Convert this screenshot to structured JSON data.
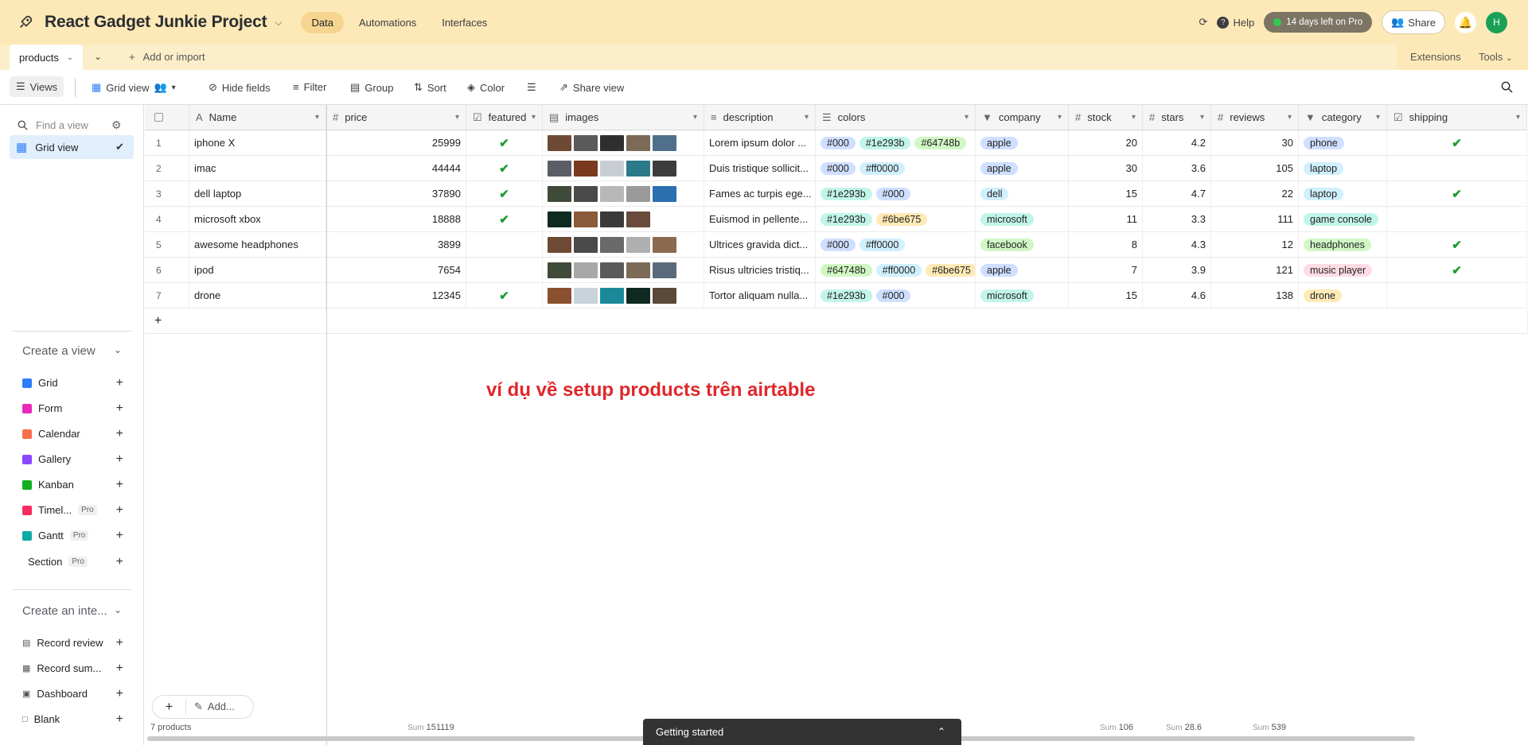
{
  "base": {
    "title": "React Gadget Junkie Project"
  },
  "nav": {
    "data": "Data",
    "automations": "Automations",
    "interfaces": "Interfaces"
  },
  "top_right": {
    "help": "Help",
    "trial": "14 days left on Pro",
    "share": "Share",
    "avatar": "H"
  },
  "table_tab": {
    "name": "products",
    "add_import": "Add or import",
    "extensions": "Extensions",
    "tools": "Tools"
  },
  "viewbar": {
    "views": "Views",
    "view_name": "Grid view",
    "hide_fields": "Hide fields",
    "filter": "Filter",
    "group": "Group",
    "sort": "Sort",
    "color": "Color",
    "share_view": "Share view"
  },
  "sidebar": {
    "find_placeholder": "Find a view",
    "current_view": "Grid view",
    "create_view": "Create a view",
    "view_types": [
      {
        "label": "Grid",
        "color": "#2d7ff9",
        "pro": ""
      },
      {
        "label": "Form",
        "color": "#e929ba",
        "pro": ""
      },
      {
        "label": "Calendar",
        "color": "#f86f4b",
        "pro": ""
      },
      {
        "label": "Gallery",
        "color": "#8b46ff",
        "pro": ""
      },
      {
        "label": "Kanban",
        "color": "#11af22",
        "pro": ""
      },
      {
        "label": "Timel...",
        "color": "#f82b60",
        "pro": "Pro"
      },
      {
        "label": "Gantt",
        "color": "#0eaaa5",
        "pro": "Pro"
      },
      {
        "label": "Section",
        "color": "",
        "pro": "Pro"
      }
    ],
    "create_interface": "Create an inte...",
    "interface_types": [
      "Record review",
      "Record sum...",
      "Dashboard",
      "Blank"
    ]
  },
  "columns": [
    "Name",
    "price",
    "featured",
    "images",
    "description",
    "colors",
    "company",
    "stock",
    "stars",
    "reviews",
    "category",
    "shipping"
  ],
  "rows": [
    {
      "n": "1",
      "name": "iphone X",
      "price": "25999",
      "featured": true,
      "images": [
        "#6e4a35",
        "#5a5a5a",
        "#2f2f2f",
        "#7a6a56",
        "#4f6f8a"
      ],
      "description": "Lorem ipsum dolor ...",
      "colors": [
        "#000",
        "#1e293b",
        "#64748b"
      ],
      "company": "apple",
      "stock": "20",
      "stars": "4.2",
      "reviews": "30",
      "category": "phone",
      "shipping": true
    },
    {
      "n": "2",
      "name": "imac",
      "price": "44444",
      "featured": true,
      "images": [
        "#5b5e66",
        "#7a3a20",
        "#c9ced5",
        "#2a7a8a",
        "#3d3d3d"
      ],
      "description": "Duis tristique sollicit...",
      "colors": [
        "#000",
        "#ff0000"
      ],
      "company": "apple",
      "stock": "30",
      "stars": "3.6",
      "reviews": "105",
      "category": "laptop",
      "shipping": false
    },
    {
      "n": "3",
      "name": "dell laptop",
      "price": "37890",
      "featured": true,
      "images": [
        "#3f4a3a",
        "#4a4a4a",
        "#b8b8b8",
        "#9a9a9a",
        "#2b6fb0"
      ],
      "description": "Fames ac turpis ege...",
      "colors": [
        "#1e293b",
        "#000"
      ],
      "company": "dell",
      "stock": "15",
      "stars": "4.7",
      "reviews": "22",
      "category": "laptop",
      "shipping": true
    },
    {
      "n": "4",
      "name": "microsoft xbox",
      "price": "18888",
      "featured": true,
      "images": [
        "#0f2a20",
        "#8a5a3a",
        "#3a3a3a",
        "#6a4a3a"
      ],
      "description": "Euismod in pellente...",
      "colors": [
        "#1e293b",
        "#6be675"
      ],
      "company": "microsoft",
      "stock": "11",
      "stars": "3.3",
      "reviews": "111",
      "category": "game console",
      "shipping": false
    },
    {
      "n": "5",
      "name": "awesome headphones",
      "price": "3899",
      "featured": false,
      "images": [
        "#6e4a35",
        "#4a4a4a",
        "#6a6a6a",
        "#b0b0b0",
        "#8a6a50"
      ],
      "description": "Ultrices gravida dict...",
      "colors": [
        "#000",
        "#ff0000"
      ],
      "company": "facebook",
      "stock": "8",
      "stars": "4.3",
      "reviews": "12",
      "category": "headphones",
      "shipping": true
    },
    {
      "n": "6",
      "name": "ipod",
      "price": "7654",
      "featured": false,
      "images": [
        "#3f4a3a",
        "#a8a8a8",
        "#5a5a5a",
        "#7a6a56",
        "#5a6a7a"
      ],
      "description": "Risus ultricies tristiq...",
      "colors": [
        "#64748b",
        "#ff0000",
        "#6be675"
      ],
      "company": "apple",
      "stock": "7",
      "stars": "3.9",
      "reviews": "121",
      "category": "music player",
      "shipping": true
    },
    {
      "n": "7",
      "name": "drone",
      "price": "12345",
      "featured": true,
      "images": [
        "#8a5030",
        "#c9d3da",
        "#1a8a9a",
        "#0f2a20",
        "#5a4a3a"
      ],
      "description": "Tortor aliquam nulla...",
      "colors": [
        "#1e293b",
        "#000"
      ],
      "company": "microsoft",
      "stock": "15",
      "stars": "4.6",
      "reviews": "138",
      "category": "drone",
      "shipping": false
    }
  ],
  "company_colors": {
    "apple": "#cfdfff",
    "dell": "#d0f0fd",
    "microsoft": "#c2f5e9",
    "facebook": "#d1f7c4"
  },
  "category_colors": {
    "phone": "#cfdfff",
    "laptop": "#d0f0fd",
    "game console": "#c2f5e9",
    "headphones": "#d1f7c4",
    "music player": "#ffdce5",
    "drone": "#ffeab6"
  },
  "color_pill_colors": {
    "#000": "#cfdfff",
    "#1e293b": "#c2f5e9",
    "#64748b": "#d1f7c4",
    "#ff0000": "#d0f0fd",
    "#6be675": "#ffeab6"
  },
  "footer": {
    "count": "7 products",
    "price_sum_label": "Sum",
    "price_sum": "151119",
    "stock_sum_label": "Sum",
    "stock_sum": "106",
    "stars_sum_label": "Sum",
    "stars_sum": "28.6",
    "reviews_sum_label": "Sum",
    "reviews_sum": "539"
  },
  "add_button": "Add...",
  "getting_started": "Getting started",
  "annotation": "ví dụ về setup products trên airtable"
}
